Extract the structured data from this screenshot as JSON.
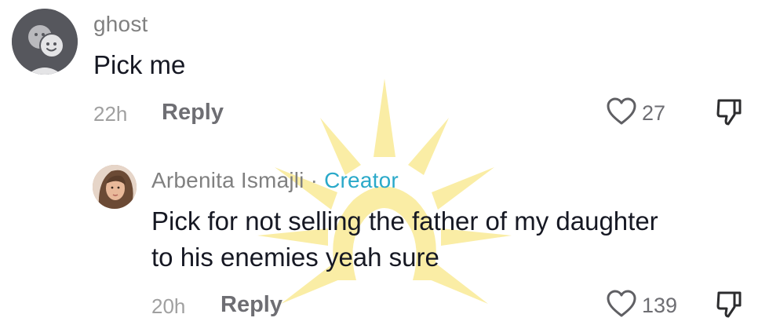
{
  "comments": [
    {
      "username": "ghost",
      "text": "Pick me",
      "time": "22h",
      "reply_label": "Reply",
      "likes": "27"
    },
    {
      "username": "Arbenita Ismajli",
      "separator": "·",
      "badge": "Creator",
      "text_line1": "Pick for not selling the father of my daughter",
      "text_line2": "to his enemies yeah sure",
      "time": "20h",
      "reply_label": "Reply",
      "likes": "139"
    }
  ],
  "icons": {
    "like": "heart-outline-icon",
    "dislike": "thumbs-down-icon",
    "default_avatar": "ghost-faces-icon"
  },
  "colors": {
    "creator_badge": "#2aa9c9",
    "watermark": "#f7e47a",
    "default_avatar_bg": "#56575d"
  }
}
